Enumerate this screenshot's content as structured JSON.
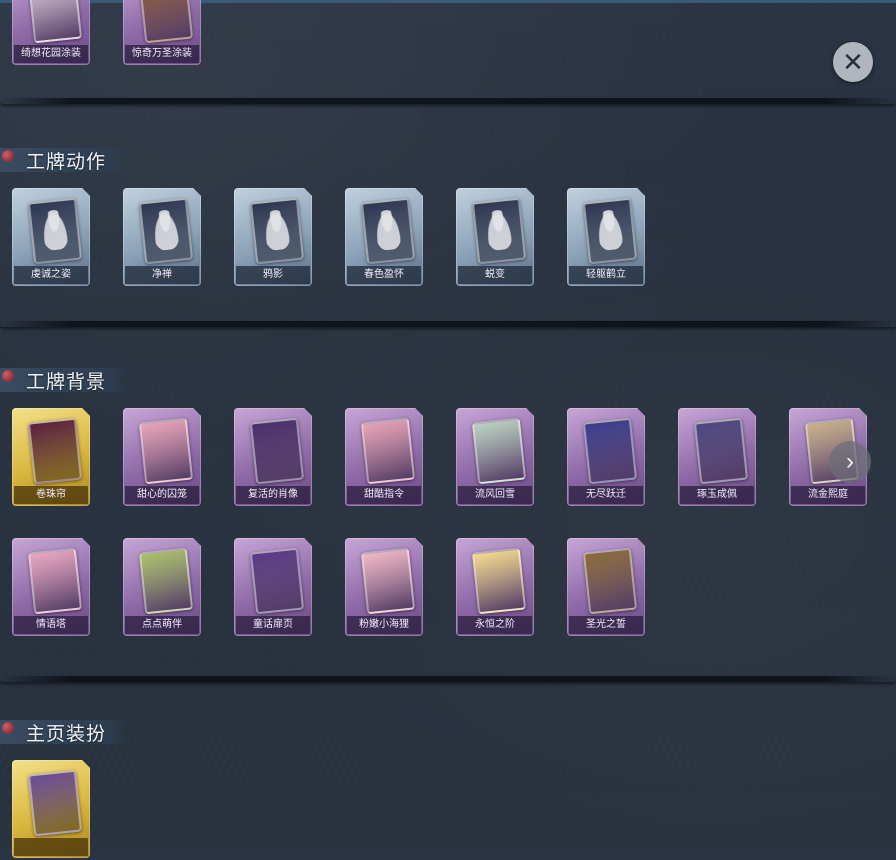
{
  "colors": {
    "background": "#29323f",
    "rarity_purple": "#8f6aa8",
    "rarity_blue": "#8ca2b8",
    "rarity_gold": "#d9b63d",
    "section_gem": "#b13a4a"
  },
  "controls": {
    "close_icon": "✕",
    "next_icon": "›"
  },
  "top_row": {
    "items": [
      {
        "label": "绮想花园涂装",
        "rarity": "purple",
        "art_color": "#d8c7d9"
      },
      {
        "label": "惊奇万圣涂装",
        "rarity": "purple",
        "art_color": "#8c5a3a"
      }
    ]
  },
  "sections": [
    {
      "title": "工牌动作",
      "items": [
        {
          "label": "虔诚之姿",
          "rarity": "blue",
          "art_color": "#2c3551"
        },
        {
          "label": "净禅",
          "rarity": "blue",
          "art_color": "#2c3551"
        },
        {
          "label": "鸦影",
          "rarity": "blue",
          "art_color": "#2c3551"
        },
        {
          "label": "春色盈怀",
          "rarity": "blue",
          "art_color": "#2c3551"
        },
        {
          "label": "蜕变",
          "rarity": "blue",
          "art_color": "#2c3551"
        },
        {
          "label": "轻躯鹤立",
          "rarity": "blue",
          "art_color": "#2c3551"
        }
      ]
    },
    {
      "title": "工牌背景",
      "items": [
        {
          "label": "卷珠帘",
          "rarity": "gold",
          "art_color": "#5a1f3c"
        },
        {
          "label": "甜心的囚笼",
          "rarity": "purple",
          "art_color": "#e9a3b6"
        },
        {
          "label": "复活的肖像",
          "rarity": "purple",
          "art_color": "#4a2e6b"
        },
        {
          "label": "甜酷指令",
          "rarity": "purple",
          "art_color": "#e6a2b4"
        },
        {
          "label": "流风回雪",
          "rarity": "purple",
          "art_color": "#b9d2c0"
        },
        {
          "label": "无尽跃迁",
          "rarity": "purple",
          "art_color": "#3a3d8c"
        },
        {
          "label": "琢玉成佩",
          "rarity": "purple",
          "art_color": "#4c4780"
        },
        {
          "label": "流金熙庭",
          "rarity": "purple",
          "art_color": "#c9b18a"
        },
        {
          "label": "情语塔",
          "rarity": "purple",
          "art_color": "#e8a6c0"
        },
        {
          "label": "点点萌伴",
          "rarity": "purple",
          "art_color": "#a9c06a"
        },
        {
          "label": "童话扉页",
          "rarity": "purple",
          "art_color": "#5a3a86"
        },
        {
          "label": "粉嫩小海狸",
          "rarity": "purple",
          "art_color": "#f0b7c4"
        },
        {
          "label": "永恒之阶",
          "rarity": "purple",
          "art_color": "#f2d98c"
        },
        {
          "label": "圣光之誓",
          "rarity": "purple",
          "art_color": "#8a6a3a"
        }
      ]
    },
    {
      "title": "主页装扮",
      "items": [
        {
          "label": "",
          "rarity": "gold",
          "art_color": "#6a4a9a"
        }
      ]
    }
  ]
}
